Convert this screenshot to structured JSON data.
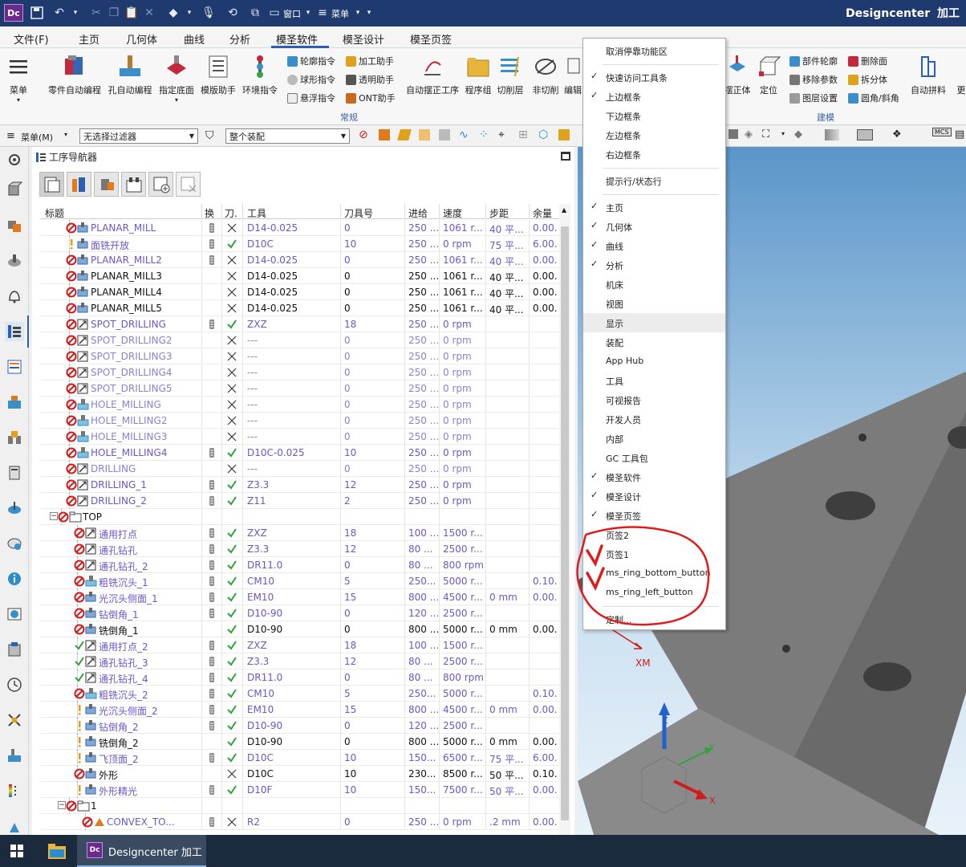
{
  "app": {
    "name": "Designcenter",
    "mode": "加工",
    "logo": "Dc",
    "window_menu_label": "窗口",
    "menu_label": "菜单"
  },
  "menubar": {
    "file": "文件(F)",
    "tabs": [
      "主页",
      "几何体",
      "曲线",
      "分析",
      "模圣软件",
      "模圣设计",
      "模圣页签"
    ],
    "active_tab_index": 4
  },
  "ribbon": {
    "menu_button": "菜单",
    "buttons": [
      "零件自动编程",
      "孔自动编程",
      "指定底面",
      "模版助手",
      "环境指令"
    ],
    "small_col1": [
      "轮廓指令",
      "球形指令",
      "悬浮指令"
    ],
    "small_col2": [
      "加工助手",
      "透明助手",
      "ONT助手"
    ],
    "buttons2": [
      "自动摆正工序",
      "程序组",
      "切削层",
      "非切削",
      "编辑"
    ],
    "group1_label": "常规",
    "right_buttons": [
      "摆正体",
      "定位"
    ],
    "small_col3": [
      "部件轮廓",
      "移除参数",
      "图层设置"
    ],
    "small_col4": [
      "删除面",
      "拆分体",
      "圆角/斜角"
    ],
    "right_button_last": "自动拼料",
    "right_button_cut": "更",
    "group2_label": "建模"
  },
  "toolbar2": {
    "menu_label": "菜单(M)",
    "filter": "无选择过滤器",
    "assembly": "整个装配"
  },
  "navigator": {
    "title": "工序导航器",
    "columns": [
      "标题",
      "换",
      "刀.",
      "工具",
      "刀具号",
      "进给",
      "速度",
      "步距",
      "余量"
    ],
    "rows": [
      {
        "indent": 2,
        "status": "no",
        "icon": "mill",
        "name": "PLANAR_MILL",
        "tl": "tl",
        "chk": "x",
        "tool": "D14-0.025",
        "num": "0",
        "feed": "250 ...",
        "speed": "1061 r...",
        "step": "40 平...",
        "stock": "0.00.",
        "color": "purple"
      },
      {
        "indent": 2,
        "status": "warn",
        "icon": "mill",
        "name": "面铣开放",
        "tl": "tl",
        "chk": "ok",
        "tool": "D10C",
        "num": "10",
        "feed": "250 ...",
        "speed": "0 rpm",
        "step": "75 平...",
        "stock": "6.00.",
        "color": "purple"
      },
      {
        "indent": 2,
        "status": "no",
        "icon": "mill",
        "name": "PLANAR_MILL2",
        "tl": "tl",
        "chk": "x",
        "tool": "D14-0.025",
        "num": "0",
        "feed": "250 ...",
        "speed": "1061 r...",
        "step": "40 平...",
        "stock": "0.00.",
        "color": "purple"
      },
      {
        "indent": 2,
        "status": "no",
        "icon": "mill",
        "name": "PLANAR_MILL3",
        "tl": "",
        "chk": "x",
        "tool": "D14-0.025",
        "num": "0",
        "feed": "250 ...",
        "speed": "1061 r...",
        "step": "40 平...",
        "stock": "0.00.",
        "color": "black"
      },
      {
        "indent": 2,
        "status": "no",
        "icon": "mill",
        "name": "PLANAR_MILL4",
        "tl": "",
        "chk": "x",
        "tool": "D14-0.025",
        "num": "0",
        "feed": "250 ...",
        "speed": "1061 r...",
        "step": "40 平...",
        "stock": "0.00.",
        "color": "black"
      },
      {
        "indent": 2,
        "status": "no",
        "icon": "mill",
        "name": "PLANAR_MILL5",
        "tl": "",
        "chk": "x",
        "tool": "D14-0.025",
        "num": "0",
        "feed": "250 ...",
        "speed": "1061 r...",
        "step": "40 平...",
        "stock": "0.00.",
        "color": "black"
      },
      {
        "indent": 2,
        "status": "no",
        "icon": "drill",
        "name": "SPOT_DRILLING",
        "tl": "tl",
        "chk": "ok",
        "tool": "ZXZ",
        "num": "18",
        "feed": "250 ...",
        "speed": "0 rpm",
        "step": "",
        "stock": "",
        "color": "purple"
      },
      {
        "indent": 2,
        "status": "no",
        "icon": "drill",
        "name": "SPOT_DRILLING2",
        "tl": "",
        "chk": "x",
        "tool": "---",
        "num": "0",
        "feed": "250 ...",
        "speed": "0 rpm",
        "step": "",
        "stock": "",
        "color": "gray"
      },
      {
        "indent": 2,
        "status": "no",
        "icon": "drill",
        "name": "SPOT_DRILLING3",
        "tl": "",
        "chk": "x",
        "tool": "---",
        "num": "0",
        "feed": "250 ...",
        "speed": "0 rpm",
        "step": "",
        "stock": "",
        "color": "gray"
      },
      {
        "indent": 2,
        "status": "no",
        "icon": "drill",
        "name": "SPOT_DRILLING4",
        "tl": "",
        "chk": "x",
        "tool": "---",
        "num": "0",
        "feed": "250 ...",
        "speed": "0 rpm",
        "step": "",
        "stock": "",
        "color": "gray"
      },
      {
        "indent": 2,
        "status": "no",
        "icon": "drill",
        "name": "SPOT_DRILLING5",
        "tl": "",
        "chk": "x",
        "tool": "---",
        "num": "0",
        "feed": "250 ...",
        "speed": "0 rpm",
        "step": "",
        "stock": "",
        "color": "gray"
      },
      {
        "indent": 2,
        "status": "no",
        "icon": "hole",
        "name": "HOLE_MILLING",
        "tl": "",
        "chk": "x",
        "tool": "---",
        "num": "0",
        "feed": "250 ...",
        "speed": "0 rpm",
        "step": "",
        "stock": "",
        "color": "gray"
      },
      {
        "indent": 2,
        "status": "no",
        "icon": "hole",
        "name": "HOLE_MILLING2",
        "tl": "",
        "chk": "x",
        "tool": "---",
        "num": "0",
        "feed": "250 ...",
        "speed": "0 rpm",
        "step": "",
        "stock": "",
        "color": "gray"
      },
      {
        "indent": 2,
        "status": "no",
        "icon": "hole",
        "name": "HOLE_MILLING3",
        "tl": "",
        "chk": "x",
        "tool": "---",
        "num": "0",
        "feed": "250 ...",
        "speed": "0 rpm",
        "step": "",
        "stock": "",
        "color": "gray"
      },
      {
        "indent": 2,
        "status": "no",
        "icon": "hole",
        "name": "HOLE_MILLING4",
        "tl": "tl",
        "chk": "ok",
        "tool": "D10C-0.025",
        "num": "10",
        "feed": "250 ...",
        "speed": "0 rpm",
        "step": "",
        "stock": "",
        "color": "purple"
      },
      {
        "indent": 2,
        "status": "no",
        "icon": "drill",
        "name": "DRILLING",
        "tl": "",
        "chk": "x",
        "tool": "---",
        "num": "0",
        "feed": "250 ...",
        "speed": "0 rpm",
        "step": "",
        "stock": "",
        "color": "gray"
      },
      {
        "indent": 2,
        "status": "no",
        "icon": "drill",
        "name": "DRILLING_1",
        "tl": "tl",
        "chk": "ok",
        "tool": "Z3.3",
        "num": "12",
        "feed": "250 ...",
        "speed": "0 rpm",
        "step": "",
        "stock": "",
        "color": "purple"
      },
      {
        "indent": 2,
        "status": "no",
        "icon": "drill",
        "name": "DRILLING_2",
        "tl": "tl",
        "chk": "ok",
        "tool": "Z11",
        "num": "2",
        "feed": "250 ...",
        "speed": "0 rpm",
        "step": "",
        "stock": "",
        "color": "purple"
      },
      {
        "indent": 1,
        "status": "no",
        "icon": "folder",
        "name": "TOP",
        "tl": "",
        "chk": "",
        "tool": "",
        "num": "",
        "feed": "",
        "speed": "",
        "step": "",
        "stock": "",
        "color": "black",
        "expander": "−"
      },
      {
        "indent": 3,
        "status": "no",
        "icon": "drill",
        "name": "通用打点",
        "tl": "tl",
        "chk": "ok",
        "tool": "ZXZ",
        "num": "18",
        "feed": "100 ...",
        "speed": "1500 r...",
        "step": "",
        "stock": "",
        "color": "purple"
      },
      {
        "indent": 3,
        "status": "no",
        "icon": "drill",
        "name": "通孔钻孔",
        "tl": "tl",
        "chk": "ok",
        "tool": "Z3.3",
        "num": "12",
        "feed": "80 ...",
        "speed": "2500 r...",
        "step": "",
        "stock": "",
        "color": "purple"
      },
      {
        "indent": 3,
        "status": "no",
        "icon": "drill",
        "name": "通孔钻孔_2",
        "tl": "tl",
        "chk": "ok",
        "tool": "DR11.0",
        "num": "0",
        "feed": "80 ...",
        "speed": "800 rpm",
        "step": "",
        "stock": "",
        "color": "purple"
      },
      {
        "indent": 3,
        "status": "no",
        "icon": "hole",
        "name": "粗铣沉头_1",
        "tl": "tl",
        "chk": "ok",
        "tool": "CM10",
        "num": "5",
        "feed": "250...",
        "speed": "5000 r...",
        "step": "",
        "stock": "0.10.",
        "color": "purple"
      },
      {
        "indent": 3,
        "status": "no",
        "icon": "mill",
        "name": "光沉头侧面_1",
        "tl": "tl",
        "chk": "ok",
        "tool": "EM10",
        "num": "15",
        "feed": "800 ...",
        "speed": "4500 r...",
        "step": "0 mm",
        "stock": "0.00.",
        "color": "purple"
      },
      {
        "indent": 3,
        "status": "no",
        "icon": "mill",
        "name": "钻倒角_1",
        "tl": "tl",
        "chk": "ok",
        "tool": "D10-90",
        "num": "0",
        "feed": "120 ...",
        "speed": "2500 r...",
        "step": "",
        "stock": "",
        "color": "purple"
      },
      {
        "indent": 3,
        "status": "no",
        "icon": "mill",
        "name": "铣倒角_1",
        "tl": "",
        "chk": "ok",
        "tool": "D10-90",
        "num": "0",
        "feed": "800 ...",
        "speed": "5000 r...",
        "step": "0 mm",
        "stock": "0.00.",
        "color": "black"
      },
      {
        "indent": 3,
        "status": "ok",
        "icon": "drill",
        "name": "通用打点_2",
        "tl": "tl",
        "chk": "ok",
        "tool": "ZXZ",
        "num": "18",
        "feed": "100 ...",
        "speed": "1500 r...",
        "step": "",
        "stock": "",
        "color": "purple"
      },
      {
        "indent": 3,
        "status": "ok",
        "icon": "drill",
        "name": "通孔钻孔_3",
        "tl": "tl",
        "chk": "ok",
        "tool": "Z3.3",
        "num": "12",
        "feed": "80 ...",
        "speed": "2500 r...",
        "step": "",
        "stock": "",
        "color": "purple"
      },
      {
        "indent": 3,
        "status": "ok",
        "icon": "drill",
        "name": "通孔钻孔_4",
        "tl": "tl",
        "chk": "ok",
        "tool": "DR11.0",
        "num": "0",
        "feed": "80 ...",
        "speed": "800 rpm",
        "step": "",
        "stock": "",
        "color": "purple"
      },
      {
        "indent": 3,
        "status": "no",
        "icon": "hole",
        "name": "粗铣沉头_2",
        "tl": "tl",
        "chk": "ok",
        "tool": "CM10",
        "num": "5",
        "feed": "250...",
        "speed": "5000 r...",
        "step": "",
        "stock": "0.10.",
        "color": "purple"
      },
      {
        "indent": 3,
        "status": "warn",
        "icon": "mill",
        "name": "光沉头侧面_2",
        "tl": "tl",
        "chk": "ok",
        "tool": "EM10",
        "num": "15",
        "feed": "800 ...",
        "speed": "4500 r...",
        "step": "0 mm",
        "stock": "0.00.",
        "color": "purple"
      },
      {
        "indent": 3,
        "status": "warn",
        "icon": "mill",
        "name": "钻倒角_2",
        "tl": "tl",
        "chk": "ok",
        "tool": "D10-90",
        "num": "0",
        "feed": "120 ...",
        "speed": "2500 r...",
        "step": "",
        "stock": "",
        "color": "purple"
      },
      {
        "indent": 3,
        "status": "warn",
        "icon": "mill",
        "name": "铣倒角_2",
        "tl": "",
        "chk": "ok",
        "tool": "D10-90",
        "num": "0",
        "feed": "800 ...",
        "speed": "5000 r...",
        "step": "0 mm",
        "stock": "0.00.",
        "color": "black"
      },
      {
        "indent": 3,
        "status": "warn",
        "icon": "mill",
        "name": "飞顶面_2",
        "tl": "tl",
        "chk": "ok",
        "tool": "D10C",
        "num": "10",
        "feed": "150...",
        "speed": "6500 r...",
        "step": "75 平...",
        "stock": "6.00.",
        "color": "purple"
      },
      {
        "indent": 3,
        "status": "no",
        "icon": "mill",
        "name": "外形",
        "tl": "",
        "chk": "x",
        "tool": "D10C",
        "num": "10",
        "feed": "230...",
        "speed": "8500 r...",
        "step": "50 平...",
        "stock": "0.10.",
        "color": "black"
      },
      {
        "indent": 3,
        "status": "warn",
        "icon": "mill",
        "name": "外形精光",
        "tl": "tl",
        "chk": "ok",
        "tool": "D10F",
        "num": "10",
        "feed": "150...",
        "speed": "7500 r...",
        "step": "50 平...",
        "stock": "0.00.",
        "color": "purple"
      },
      {
        "indent": 2,
        "status": "no",
        "icon": "folder",
        "name": "1",
        "tl": "",
        "chk": "",
        "tool": "",
        "num": "",
        "feed": "",
        "speed": "",
        "step": "",
        "stock": "",
        "color": "black",
        "expander": "−"
      },
      {
        "indent": 4,
        "status": "no",
        "icon": "convex",
        "name": "CONVEX_TO...",
        "tl": "tl",
        "chk": "x",
        "tool": "R2",
        "num": "0",
        "feed": "250 ...",
        "speed": "0 rpm",
        "step": ".2 mm",
        "stock": "0.00.",
        "color": "purple"
      }
    ]
  },
  "context_menu": {
    "items": [
      {
        "label": "取消停靠功能区",
        "checked": false
      },
      {
        "sep": true
      },
      {
        "label": "快速访问工具条",
        "checked": true
      },
      {
        "label": "上边框条",
        "checked": true
      },
      {
        "label": "下边框条",
        "checked": false
      },
      {
        "label": "左边框条",
        "checked": false
      },
      {
        "label": "右边框条",
        "checked": false
      },
      {
        "sep": true
      },
      {
        "label": "提示行/状态行",
        "checked": false
      },
      {
        "sep": true
      },
      {
        "label": "主页",
        "checked": true
      },
      {
        "label": "几何体",
        "checked": true
      },
      {
        "label": "曲线",
        "checked": true
      },
      {
        "label": "分析",
        "checked": true
      },
      {
        "label": "机床",
        "checked": false
      },
      {
        "label": "视图",
        "checked": false
      },
      {
        "label": "显示",
        "checked": false,
        "highlight": true
      },
      {
        "label": "装配",
        "checked": false
      },
      {
        "label": "App Hub",
        "checked": false
      },
      {
        "label": "工具",
        "checked": false
      },
      {
        "label": "可视报告",
        "checked": false
      },
      {
        "label": "开发人员",
        "checked": false
      },
      {
        "label": "内部",
        "checked": false
      },
      {
        "label": "GC 工具包",
        "checked": false
      },
      {
        "label": "模圣软件",
        "checked": true
      },
      {
        "label": "模圣设计",
        "checked": true
      },
      {
        "label": "模圣页签",
        "checked": true
      },
      {
        "label": "页签2",
        "checked": false
      },
      {
        "label": "页签1",
        "checked": false
      },
      {
        "label": "ms_ring_bottom_button",
        "checked": false
      },
      {
        "label": "ms_ring_left_button",
        "checked": false
      },
      {
        "sep": true
      },
      {
        "label": "定制...",
        "checked": false
      }
    ]
  },
  "viewport": {
    "axis_z": "Z",
    "axis_y": "Y",
    "axis_x": "X",
    "xm_label": "XM",
    "mcs_label": "MCS"
  },
  "taskbar": {
    "app_label": "Designcenter 加工",
    "logo": "Dc"
  },
  "colors": {
    "titlebar": "#1f3a6e",
    "accent": "#2b5fb3",
    "purple_op": "#6d56c9",
    "annotation_red": "#e01b1b"
  }
}
